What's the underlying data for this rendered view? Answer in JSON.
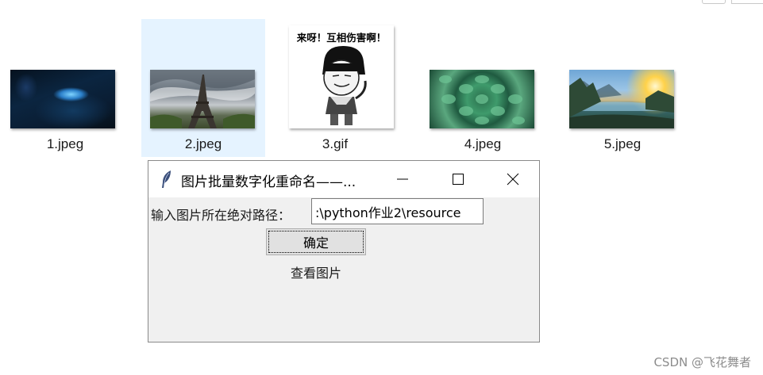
{
  "files": [
    {
      "name": "1.jpeg",
      "selected": false
    },
    {
      "name": "2.jpeg",
      "selected": true
    },
    {
      "name": "3.gif",
      "selected": false,
      "caption": "来呀！互相伤害啊！"
    },
    {
      "name": "4.jpeg",
      "selected": false
    },
    {
      "name": "5.jpeg",
      "selected": false
    }
  ],
  "dialog": {
    "title": "图片批量数字化重命名——...",
    "app_icon": "feather-icon",
    "controls": [
      "minimize-icon",
      "maximize-icon",
      "close-icon"
    ],
    "path_label": "输入图片所在绝对路径：",
    "path_value": ":\\python作业2\\resource",
    "confirm_label": "确定",
    "view_label": "查看图片"
  },
  "watermark": "CSDN @飞花舞者",
  "colors": {
    "selection": "#e5f3ff",
    "dialog_bg": "#f0f0f0",
    "button_bg": "#e1e1e1"
  }
}
